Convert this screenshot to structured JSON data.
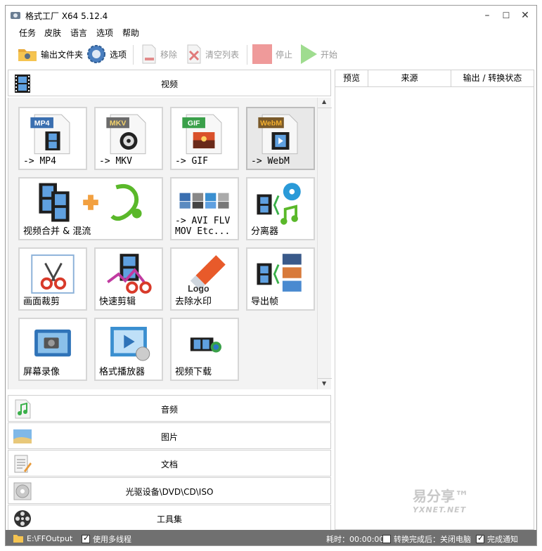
{
  "window": {
    "title": "格式工厂 X64 5.12.4",
    "min": "–",
    "max": "☐",
    "close": "✕"
  },
  "menu": [
    "任务",
    "皮肤",
    "语言",
    "选项",
    "帮助"
  ],
  "toolbar": {
    "output_folder": "输出文件夹",
    "options": "选项",
    "remove": "移除",
    "clear_list": "清空列表",
    "stop": "停止",
    "start": "开始"
  },
  "categories": {
    "video": "视频",
    "audio": "音频",
    "image": "图片",
    "document": "文档",
    "disc": "光驱设备\\DVD\\CD\\ISO",
    "tools": "工具集"
  },
  "tiles": [
    {
      "label": "-> MP4",
      "badge": "MP4",
      "badge_color": "#3a6fb0"
    },
    {
      "label": "-> MKV",
      "badge": "MKV",
      "badge_color": "#6b6b6b"
    },
    {
      "label": "-> GIF",
      "badge": "GIF",
      "badge_color": "#3aa04a"
    },
    {
      "label": "-> WebM",
      "badge": "WebM",
      "badge_color": "#7a5a2a"
    },
    {
      "label": "视频合并 & 混流"
    },
    {
      "label": "-> AVI FLV\nMOV Etc..."
    },
    {
      "label": "分离器"
    },
    {
      "label": "画面裁剪"
    },
    {
      "label": "快速剪辑"
    },
    {
      "label": "去除水印",
      "art_text": "Logo"
    },
    {
      "label": "导出帧"
    },
    {
      "label": "屏幕录像"
    },
    {
      "label": "格式播放器"
    },
    {
      "label": "视频下载"
    }
  ],
  "task_columns": [
    "预览",
    "来源",
    "输出 / 转换状态"
  ],
  "watermark": {
    "main": "易分享™",
    "sub": "YXNET.NET"
  },
  "status": {
    "path": "E:\\FFOutput",
    "multithread": "使用多线程",
    "elapsed": "耗时：00:00:00",
    "after_convert": "转换完成后：关闭电脑",
    "notify": "完成通知"
  }
}
